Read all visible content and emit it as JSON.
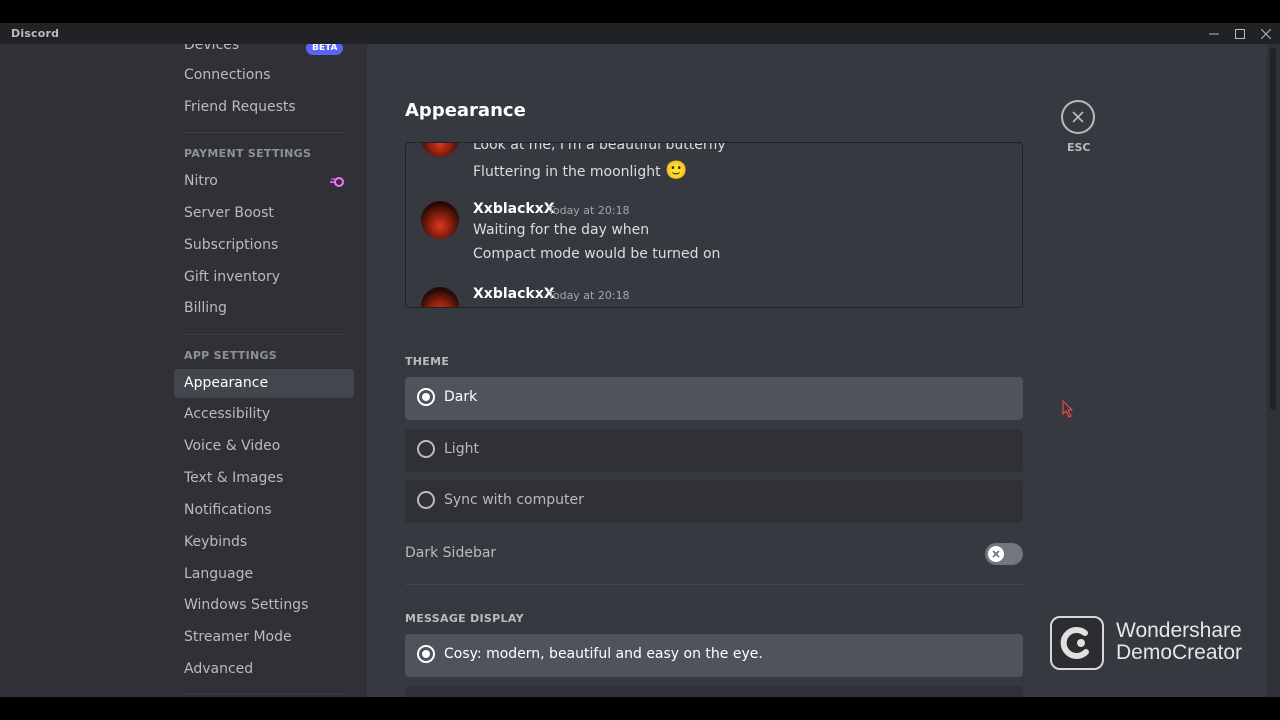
{
  "window": {
    "title": "Discord"
  },
  "sidebar": {
    "devices": {
      "label": "Devices",
      "badge": "BETA"
    },
    "connections": "Connections",
    "friend_requests": "Friend Requests",
    "payment_header": "PAYMENT SETTINGS",
    "nitro": "Nitro",
    "server_boost": "Server Boost",
    "subscriptions": "Subscriptions",
    "gift_inventory": "Gift inventory",
    "billing": "Billing",
    "app_header": "APP SETTINGS",
    "appearance": "Appearance",
    "accessibility": "Accessibility",
    "voice_video": "Voice & Video",
    "text_images": "Text & Images",
    "notifications": "Notifications",
    "keybinds": "Keybinds",
    "language": "Language",
    "windows_settings": "Windows Settings",
    "streamer_mode": "Streamer Mode",
    "advanced": "Advanced"
  },
  "main": {
    "title": "Appearance",
    "close_label": "ESC",
    "preview": {
      "line1": "Look at me, I'm a beautiful butterfly",
      "line2": "Fluttering in the moonlight",
      "emoji": "🙂",
      "msg2_user": "XxblackxX",
      "msg2_time": "Today at 20:18",
      "msg2_line1": "Waiting for the day when",
      "msg2_line2": "Compact mode would be turned on",
      "msg3_user": "XxblackxX",
      "msg3_time": "Today at 20:18"
    },
    "theme_label": "THEME",
    "theme_options": [
      "Dark",
      "Light",
      "Sync with computer"
    ],
    "theme_selected": "Dark",
    "dark_sidebar_label": "Dark Sidebar",
    "dark_sidebar_enabled": false,
    "message_display_label": "MESSAGE DISPLAY",
    "message_display_option": "Cosy: modern, beautiful and easy on the eye."
  },
  "watermark": {
    "line1": "Wondershare",
    "line2": "DemoCreator"
  },
  "colors": {
    "accent": "#5865f2",
    "nitro": "#ff73fa",
    "background": "#36393f",
    "sidebar": "#2f3136"
  }
}
